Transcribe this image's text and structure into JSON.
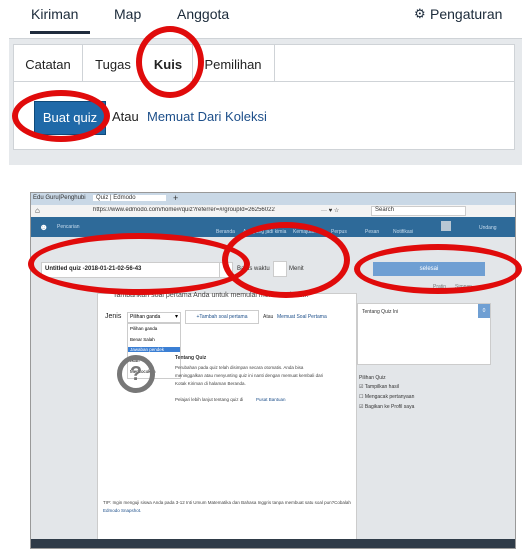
{
  "top_nav": {
    "items": [
      "Kiriman",
      "Map",
      "Anggota"
    ],
    "settings_label": "Pengaturan"
  },
  "tabs": [
    "Catatan",
    "Tugas",
    "Kuis",
    "Pemilihan"
  ],
  "actions": {
    "create_quiz": "Buat quiz",
    "or_label": "Atau",
    "load_collection": "Memuat Dari Koleksi"
  },
  "browser": {
    "tab1": "Edu Guru|Penghubi",
    "tab2": "Quiz | Edmodo",
    "url": "https://www.edmodo.com/home#/quiz?referrer=#/groupId=26256022",
    "search_placeholder": "Search"
  },
  "app_nav": {
    "search": "Pencarian",
    "items": [
      "Beranda",
      "Apa yang jadi kimia",
      "Kemajuan",
      "Perpus",
      "Pesan",
      "Notifikasi"
    ],
    "user": "Undang"
  },
  "quiz": {
    "title": "Untitled quiz -2018-01-21-02-56-43",
    "time_label": "Batas waktu",
    "minutes_label": "Menit",
    "finish_button": "selesai",
    "preview": "Pratin",
    "save": "Simpan",
    "intro": "Tambahkan soal pertama Anda untuk memulai membuat kuis...",
    "type_label": "Jenis",
    "type_value": "Pilihan ganda",
    "add_first": "+Tambah soal pertama",
    "or_load": "Atau",
    "load_link": "Memuat Soal Pertama",
    "type_options": [
      "Pilihan ganda",
      "Benar Salah",
      "Jawaban pendek",
      "Isian",
      "Mencocokan"
    ],
    "info_title": "Tentang Quiz",
    "info_text": [
      "Perubahan pada quiz telah disimpan secara otomatis. Anda bisa",
      "meninggalkan atau menyunting quiz ini nanti dengan memuat kembali dari",
      "Kotak Kiriman di halaman Beranda."
    ],
    "help_text": "Pelajari lebih lanjut tentang quiz di",
    "help_link": "Pusat Bantuan",
    "tip": "TIP: Ingin menguji siswa Anda pada 3-12 Inti Umum Matematika dan Bahasa Inggris tanpa membuat satu soal pun?Cobalah",
    "tip_link": "Edmodo Snapshot.",
    "sidebar_title": "Tentang Quiz Ini",
    "sidebar_count": "0",
    "options_title": "Pilihan Quiz",
    "options": [
      {
        "label": "Tampilkan hasil",
        "checked": true
      },
      {
        "label": "Mengacak pertanyaan",
        "checked": false
      },
      {
        "label": "Bagikan ke Profil saya",
        "checked": true
      }
    ]
  },
  "colors": {
    "annotation": "#e00b0b",
    "primary_button": "#1f69a8",
    "app_bar": "#2e6a99"
  }
}
